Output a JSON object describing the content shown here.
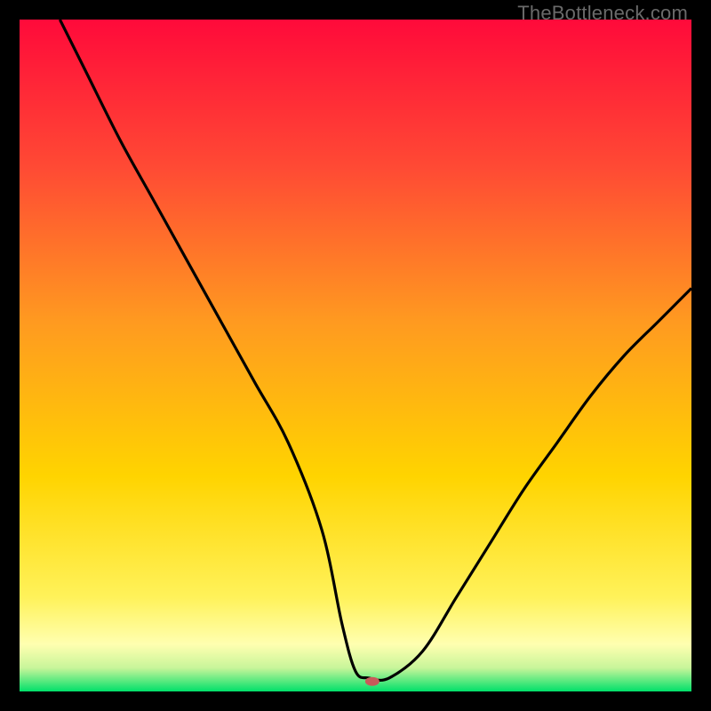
{
  "watermark": "TheBottleneck.com",
  "chart_data": {
    "type": "line",
    "title": "",
    "xlabel": "",
    "ylabel": "",
    "xlim": [
      0,
      100
    ],
    "ylim": [
      0,
      100
    ],
    "grid": false,
    "legend": false,
    "background": {
      "type": "vertical-gradient",
      "stops": [
        {
          "pos": 0.0,
          "color": "#ff0a3a"
        },
        {
          "pos": 0.22,
          "color": "#ff4a34"
        },
        {
          "pos": 0.45,
          "color": "#ff9a20"
        },
        {
          "pos": 0.68,
          "color": "#ffd400"
        },
        {
          "pos": 0.86,
          "color": "#fff25a"
        },
        {
          "pos": 0.93,
          "color": "#ffffb0"
        },
        {
          "pos": 0.965,
          "color": "#c8f59a"
        },
        {
          "pos": 1.0,
          "color": "#00e06a"
        }
      ]
    },
    "series": [
      {
        "name": "bottleneck-curve",
        "color": "#000000",
        "x": [
          6,
          10,
          15,
          20,
          25,
          30,
          35,
          40,
          45,
          48,
          50,
          52,
          55,
          60,
          65,
          70,
          75,
          80,
          85,
          90,
          95,
          100
        ],
        "values": [
          100,
          92,
          82,
          73,
          64,
          55,
          46,
          37,
          24,
          10,
          3,
          2,
          2,
          6,
          14,
          22,
          30,
          37,
          44,
          50,
          55,
          60
        ]
      }
    ],
    "marker": {
      "name": "min-point",
      "x": 52.5,
      "y": 1.5,
      "color": "#c85a5a",
      "rx": 8,
      "ry": 5
    }
  }
}
